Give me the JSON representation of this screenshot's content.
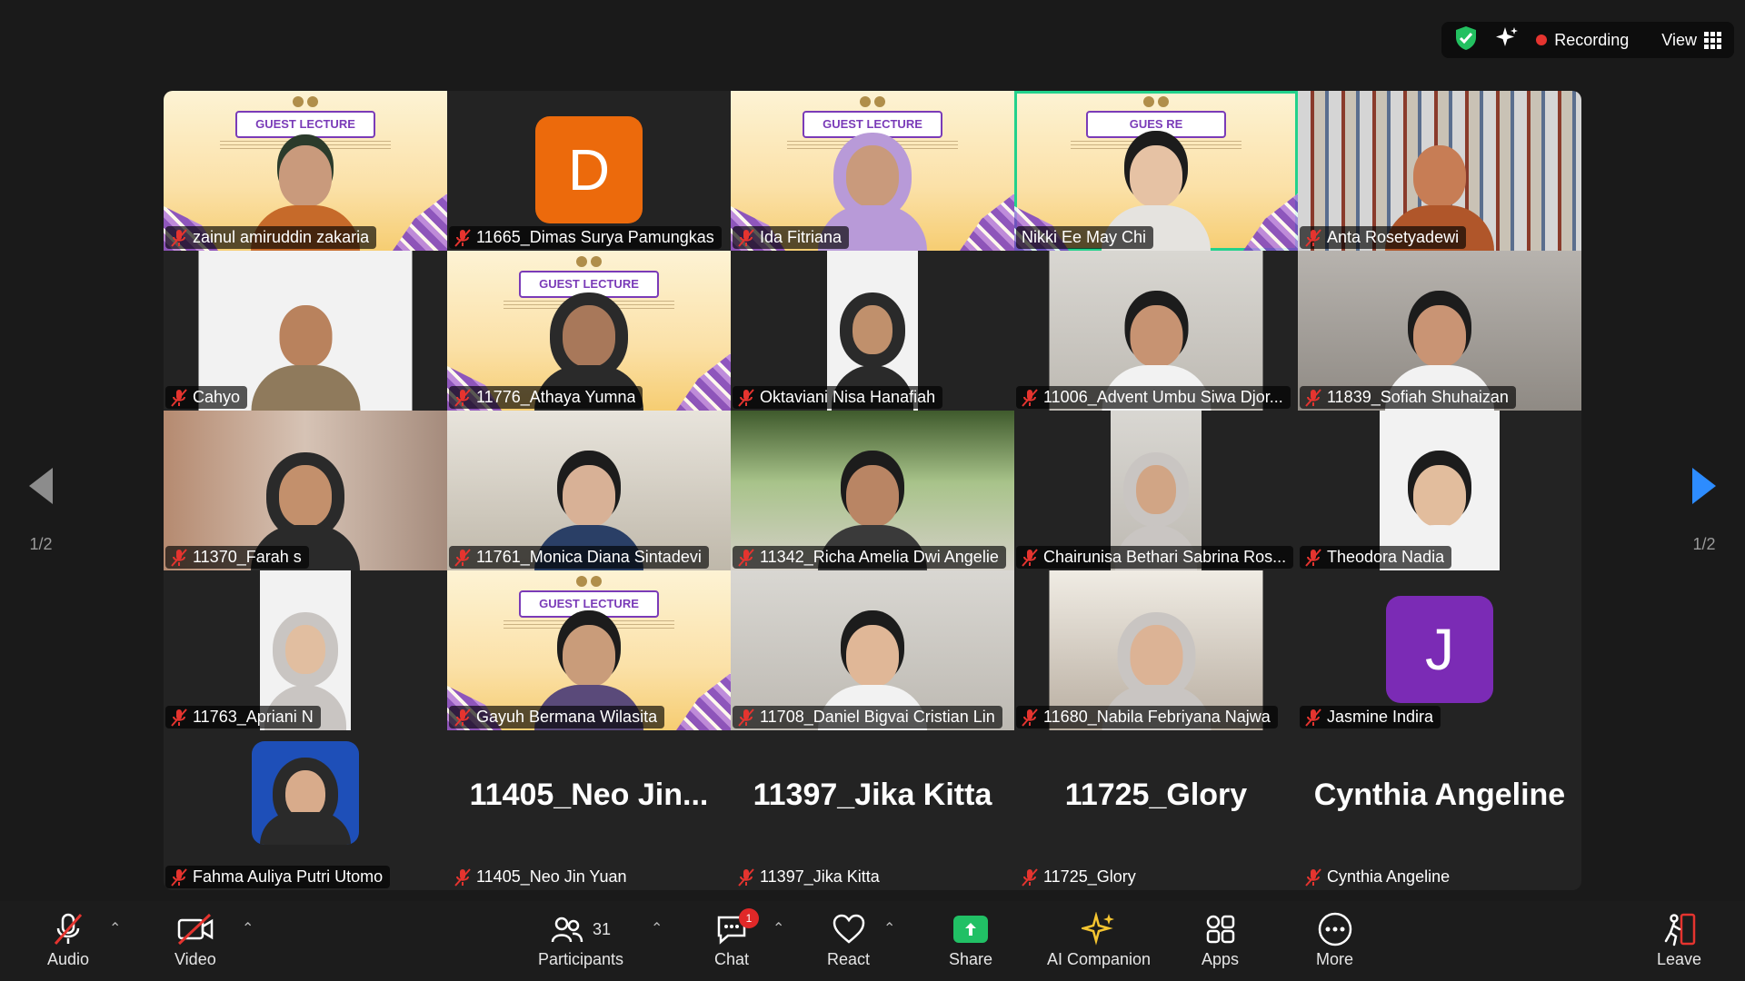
{
  "status": {
    "recording_label": "Recording",
    "view_label": "View",
    "icons": [
      "shield-check-icon",
      "sparkle-icon",
      "grid-icon"
    ]
  },
  "nav": {
    "left_page": "1/2",
    "right_page": "1/2"
  },
  "participants": [
    {
      "name": "zainul amiruddin zakaria",
      "muted": true
    },
    {
      "name": "11665_Dimas Surya Pamungkas",
      "muted": true,
      "avatar_letter": "D",
      "avatar_color": "#ec6a0c"
    },
    {
      "name": "Ida Fitriana",
      "muted": true
    },
    {
      "name": "Nikki Ee May Chi",
      "muted": false,
      "speaking": true
    },
    {
      "name": "Anta Rosetyadewi",
      "muted": true
    },
    {
      "name": "Cahyo",
      "muted": true
    },
    {
      "name": "11776_Athaya Yumna",
      "muted": true
    },
    {
      "name": "Oktaviani Nisa Hanafiah",
      "muted": true
    },
    {
      "name": "11006_Advent Umbu Siwa Djor...",
      "muted": true
    },
    {
      "name": "11839_Sofiah Shuhaizan",
      "muted": true
    },
    {
      "name": "11370_Farah s",
      "muted": true
    },
    {
      "name": "11761_Monica Diana Sintadevi",
      "muted": true
    },
    {
      "name": "11342_Richa Amelia Dwi Angelie",
      "muted": true
    },
    {
      "name": "Chairunisa Bethari Sabrina Ros...",
      "muted": true
    },
    {
      "name": "Theodora Nadia",
      "muted": true
    },
    {
      "name": "11763_Apriani N",
      "muted": true
    },
    {
      "name": "Gayuh Bermana Wilasita",
      "muted": true
    },
    {
      "name": "11708_Daniel Bigvai Cristian Lin",
      "muted": true
    },
    {
      "name": "11680_Nabila Febriyana Najwa",
      "muted": true
    },
    {
      "name": "Jasmine Indira",
      "muted": true,
      "avatar_letter": "J",
      "avatar_color": "#7b2bb5"
    },
    {
      "name": "Fahma Auliya Putri Utomo",
      "muted": true
    },
    {
      "name": "11405_Neo Jin Yuan",
      "muted": true,
      "big_label": "11405_Neo  Jin..."
    },
    {
      "name": "11397_Jika Kitta",
      "muted": true,
      "big_label": "11397_Jika Kitta"
    },
    {
      "name": "11725_Glory",
      "muted": true,
      "big_label": "11725_Glory"
    },
    {
      "name": "Cynthia Angeline",
      "muted": true,
      "big_label": "Cynthia Angeline"
    }
  ],
  "lecture_banner": "GUEST LECTURE",
  "lecture_banner_partial": "GUES       RE",
  "toolbar": {
    "audio": "Audio",
    "video": "Video",
    "participants": "Participants",
    "participants_count": "31",
    "chat": "Chat",
    "chat_badge": "1",
    "react": "React",
    "share": "Share",
    "ai_companion": "AI Companion",
    "apps": "Apps",
    "more": "More",
    "leave": "Leave"
  },
  "colors": {
    "speaking_border": "#23d18b",
    "mute_red": "#e5342f",
    "share_green": "#21c065",
    "accent_blue": "#2d8cff",
    "ai_yellow": "#f5c531"
  }
}
